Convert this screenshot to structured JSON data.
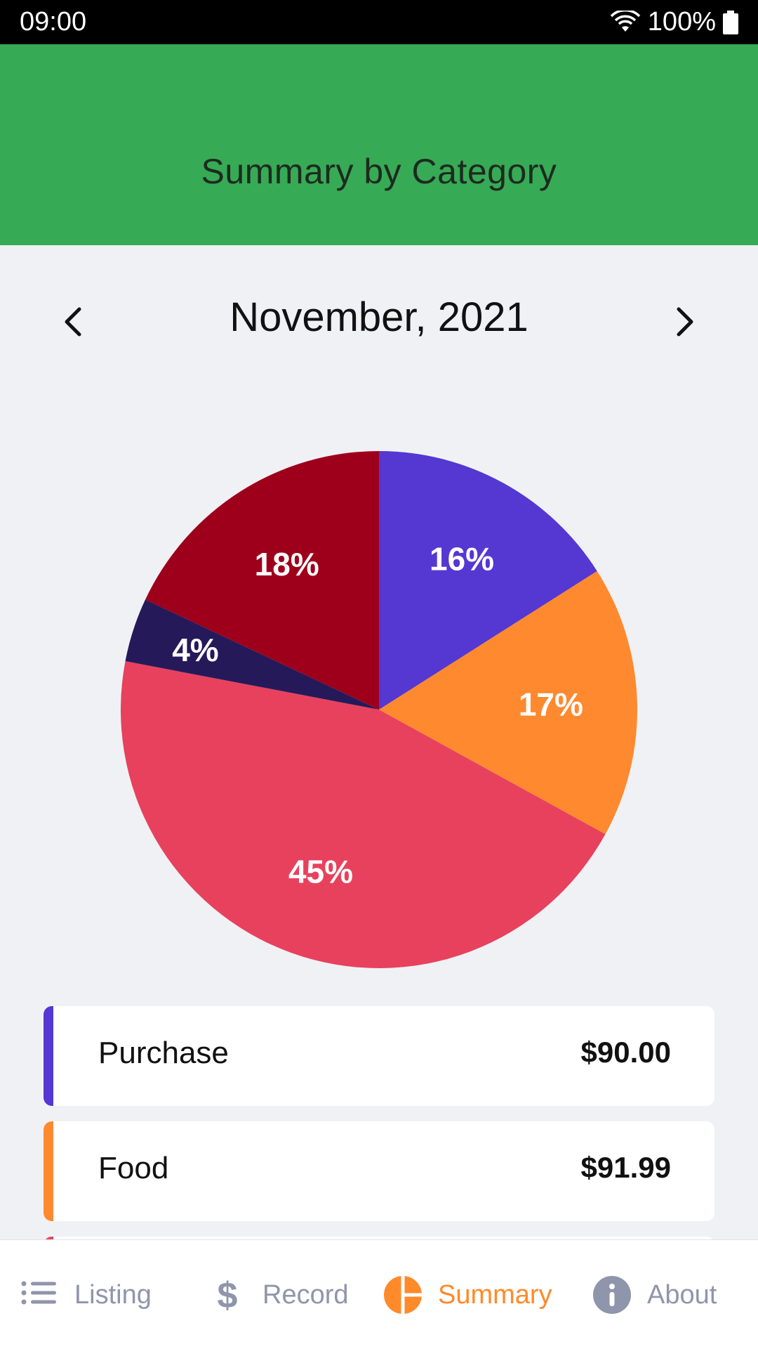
{
  "status_bar": {
    "time": "09:00",
    "battery": "100%"
  },
  "header": {
    "title": "Summary by Category"
  },
  "month_nav": {
    "label": "November, 2021"
  },
  "chart_data": {
    "type": "pie",
    "slices": [
      {
        "label": "16%",
        "value": 16,
        "color": "#5537d2"
      },
      {
        "label": "17%",
        "value": 17,
        "color": "#ff892e"
      },
      {
        "label": "45%",
        "value": 45,
        "color": "#e8415d"
      },
      {
        "label": "4%",
        "value": 4,
        "color": "#26195a"
      },
      {
        "label": "18%",
        "value": 18,
        "color": "#9e001b"
      }
    ]
  },
  "categories": [
    {
      "name": "Purchase",
      "amount": "$90.00",
      "color": "#5537d2"
    },
    {
      "name": "Food",
      "amount": "$91.99",
      "color": "#ff892e"
    }
  ],
  "bottom_nav": {
    "listing": "Listing",
    "record": "Record",
    "summary": "Summary",
    "about": "About",
    "active_color": "#ff8a2a",
    "inactive_color": "#8f95ab"
  }
}
